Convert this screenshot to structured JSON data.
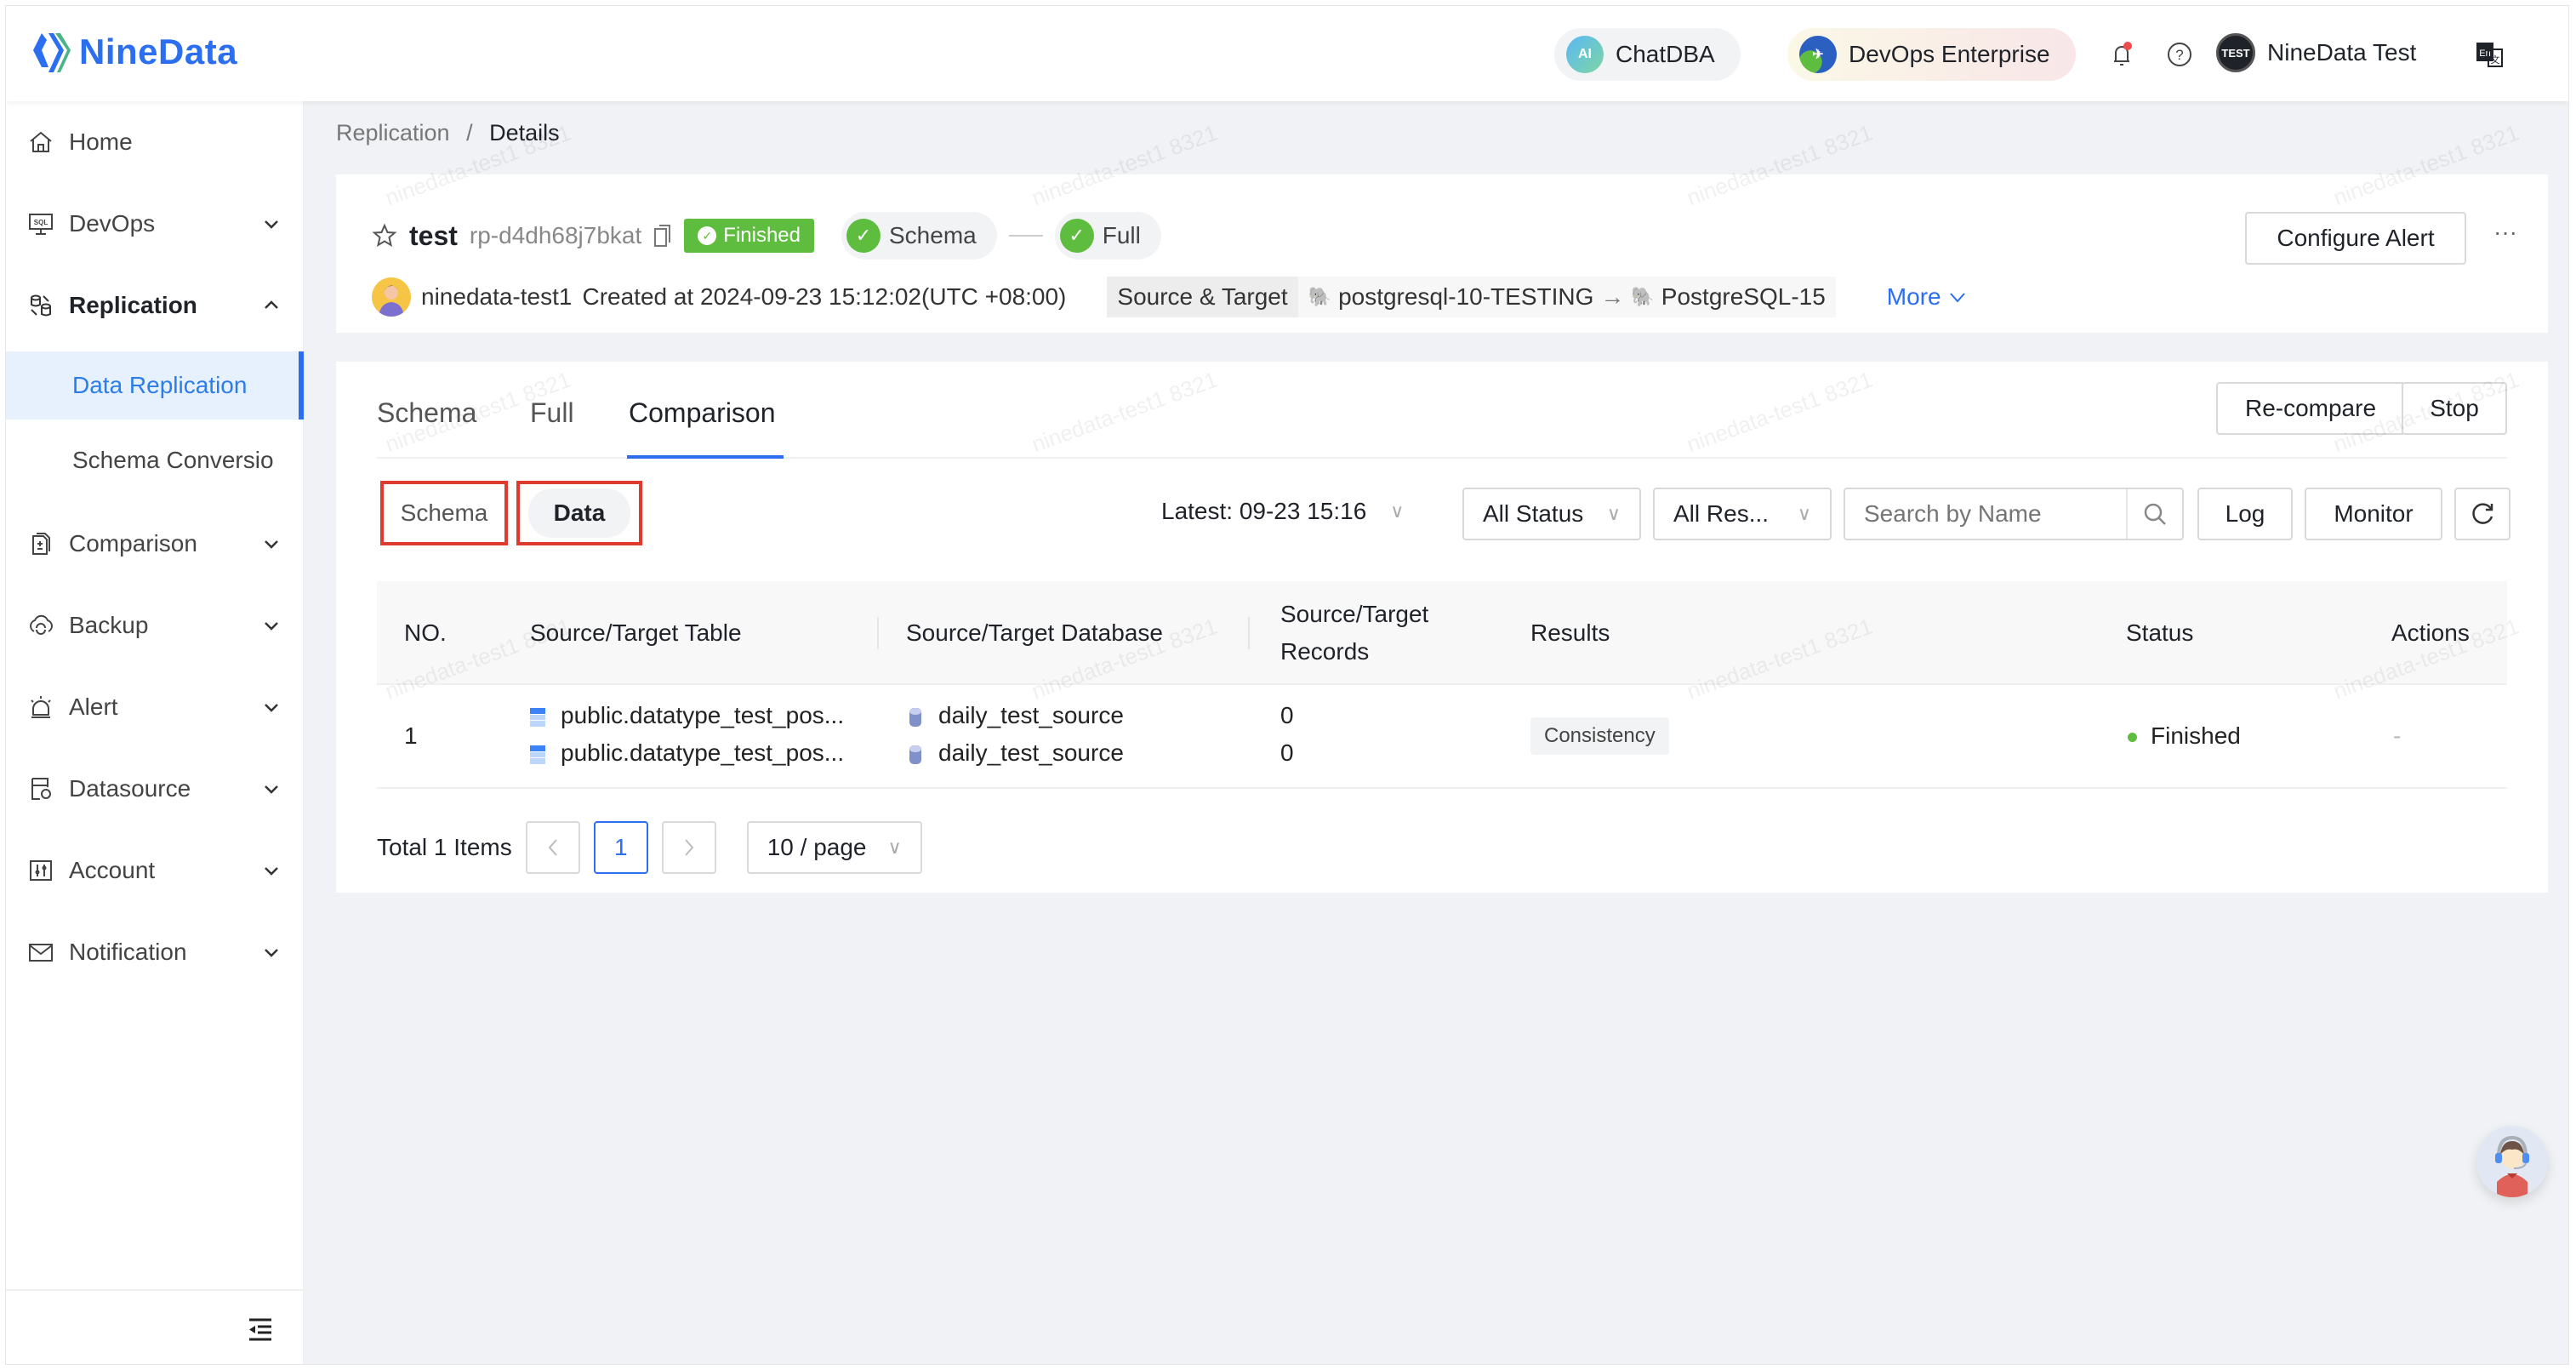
{
  "topbar": {
    "brand": "NineData",
    "chatdba_label": "ChatDBA",
    "chatdba_icon_text": "AI",
    "devops_label": "DevOps Enterprise",
    "user_name": "NineData Test",
    "user_avatar_text": "TEST",
    "language_icon_text": "En"
  },
  "sidebar": {
    "items": [
      {
        "label": "Home",
        "icon": "home-icon"
      },
      {
        "label": "DevOps",
        "icon": "sql-monitor-icon"
      },
      {
        "label": "Replication",
        "icon": "replication-icon"
      },
      {
        "label": "Data Replication"
      },
      {
        "label": "Schema Conversio"
      },
      {
        "label": "Comparison",
        "icon": "comparison-icon"
      },
      {
        "label": "Backup",
        "icon": "backup-icon"
      },
      {
        "label": "Alert",
        "icon": "alert-icon"
      },
      {
        "label": "Datasource",
        "icon": "datasource-icon"
      },
      {
        "label": "Account",
        "icon": "account-icon"
      },
      {
        "label": "Notification",
        "icon": "mail-icon"
      }
    ]
  },
  "breadcrumb": {
    "parent": "Replication",
    "separator": "/",
    "current": "Details"
  },
  "task": {
    "name": "test",
    "id": "rp-d4dh68j7bkat",
    "status": "Finished",
    "steps": [
      "Schema",
      "Full"
    ],
    "creator": "ninedata-test1",
    "created_text": "Created at 2024-09-23 15:12:02(UTC +08:00)",
    "source_target_label": "Source & Target",
    "source": "postgresql-10-TESTING",
    "target": "PostgreSQL-15",
    "more_label": "More",
    "configure_alert_label": "Configure Alert",
    "more_actions": "···"
  },
  "tabs": [
    {
      "label": "Schema"
    },
    {
      "label": "Full"
    },
    {
      "label": "Comparison",
      "active": true
    }
  ],
  "actions": {
    "recompare": "Re-compare",
    "stop": "Stop"
  },
  "segments": {
    "schema": "Schema",
    "data": "Data",
    "active": "Data"
  },
  "filters": {
    "latest": "Latest: 09-23 15:16",
    "status": "All Status",
    "results": "All Res...",
    "search_placeholder": "Search by Name",
    "log": "Log",
    "monitor": "Monitor"
  },
  "table": {
    "columns": [
      "NO.",
      "Source/Target Table",
      "Source/Target Database",
      "Source/Target",
      "Records",
      "Results",
      "Status",
      "Actions"
    ],
    "rows": [
      {
        "no": "1",
        "source_table": "public.datatype_test_pos...",
        "target_table": "public.datatype_test_pos...",
        "source_db": "daily_test_source",
        "target_db": "daily_test_source",
        "source_records": "0",
        "target_records": "0",
        "result": "Consistency",
        "status": "Finished",
        "actions": "-"
      }
    ]
  },
  "pagination": {
    "total": "Total 1 Items",
    "current_page": "1",
    "page_size": "10 / page"
  },
  "watermark": "ninedata-test1 8321",
  "colors": {
    "primary": "#2b6ef0",
    "success": "#5ebd3f",
    "highlight": "#e03a2e"
  }
}
